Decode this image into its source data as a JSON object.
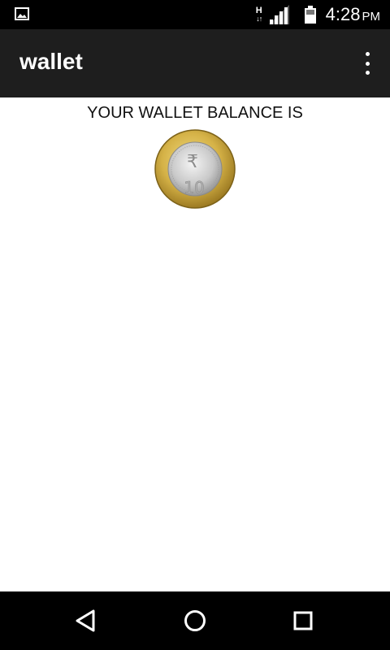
{
  "status_bar": {
    "left_icon": "image-icon",
    "network_type": "H",
    "network_arrows": "↓↑",
    "signal_icon": "signal-icon",
    "battery_icon": "battery-icon",
    "time": "4:28",
    "ampm": "PM"
  },
  "app_bar": {
    "title": "wallet",
    "overflow_icon": "more-vert-icon"
  },
  "main": {
    "balance_label": "YOUR WALLET BALANCE IS",
    "coin": {
      "icon": "ten-rupee-coin",
      "currency_symbol": "₹",
      "denomination": "10"
    }
  },
  "nav_bar": {
    "back_icon": "back-icon",
    "home_icon": "home-icon",
    "recent_icon": "recent-apps-icon"
  }
}
